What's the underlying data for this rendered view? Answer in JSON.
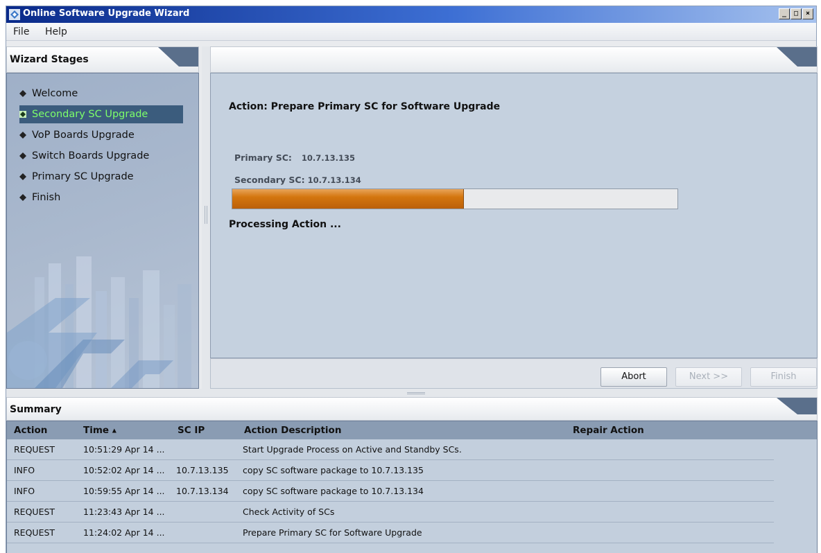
{
  "window": {
    "title": "Online Software Upgrade Wizard",
    "controls": [
      "_",
      "□",
      "×"
    ]
  },
  "menu": {
    "items": [
      "File",
      "Help"
    ]
  },
  "wizard_stages": {
    "header": "Wizard Stages",
    "items": [
      {
        "label": "Welcome",
        "selected": false
      },
      {
        "label": "Secondary SC Upgrade",
        "selected": true
      },
      {
        "label": "VoP Boards Upgrade",
        "selected": false
      },
      {
        "label": "Switch Boards Upgrade",
        "selected": false
      },
      {
        "label": "Primary SC Upgrade",
        "selected": false
      },
      {
        "label": "Finish",
        "selected": false
      }
    ]
  },
  "main": {
    "action_title": "Action: Prepare Primary SC for Software Upgrade",
    "primary_sc": {
      "label": "Primary SC:",
      "value": "10.7.13.135"
    },
    "secondary_sc": {
      "label": "Secondary SC:",
      "value": "10.7.13.134"
    },
    "progress_fraction": 0.52,
    "status": "Processing Action ..."
  },
  "buttons": {
    "abort": "Abort",
    "next": "Next >>",
    "finish": "Finish"
  },
  "summary": {
    "header": "Summary",
    "columns": [
      "Action",
      "Time",
      "SC IP",
      "Action Description",
      "Repair Action"
    ],
    "sort_indicator": "▲",
    "rows": [
      {
        "action": "REQUEST",
        "time": "10:51:29 Apr 14 ...",
        "ip": "",
        "description": "Start Upgrade Process on Active and Standby SCs.",
        "repair": ""
      },
      {
        "action": "INFO",
        "time": "10:52:02 Apr 14 ...",
        "ip": "10.7.13.135",
        "description": "copy SC software package to 10.7.13.135",
        "repair": ""
      },
      {
        "action": "INFO",
        "time": "10:59:55 Apr 14 ...",
        "ip": "10.7.13.134",
        "description": "copy SC software package to 10.7.13.134",
        "repair": ""
      },
      {
        "action": "REQUEST",
        "time": "11:23:43 Apr 14 ...",
        "ip": "",
        "description": "Check Activity of SCs",
        "repair": ""
      },
      {
        "action": "REQUEST",
        "time": "11:24:02 Apr 14 ...",
        "ip": "",
        "description": "Prepare Primary SC for Software Upgrade",
        "repair": ""
      }
    ]
  },
  "colors": {
    "progress": "#d4760e",
    "selected_stage_bg": "#3b5c7d",
    "selected_stage_text": "#7dff6a",
    "panel_blue": "#c5d1df"
  }
}
